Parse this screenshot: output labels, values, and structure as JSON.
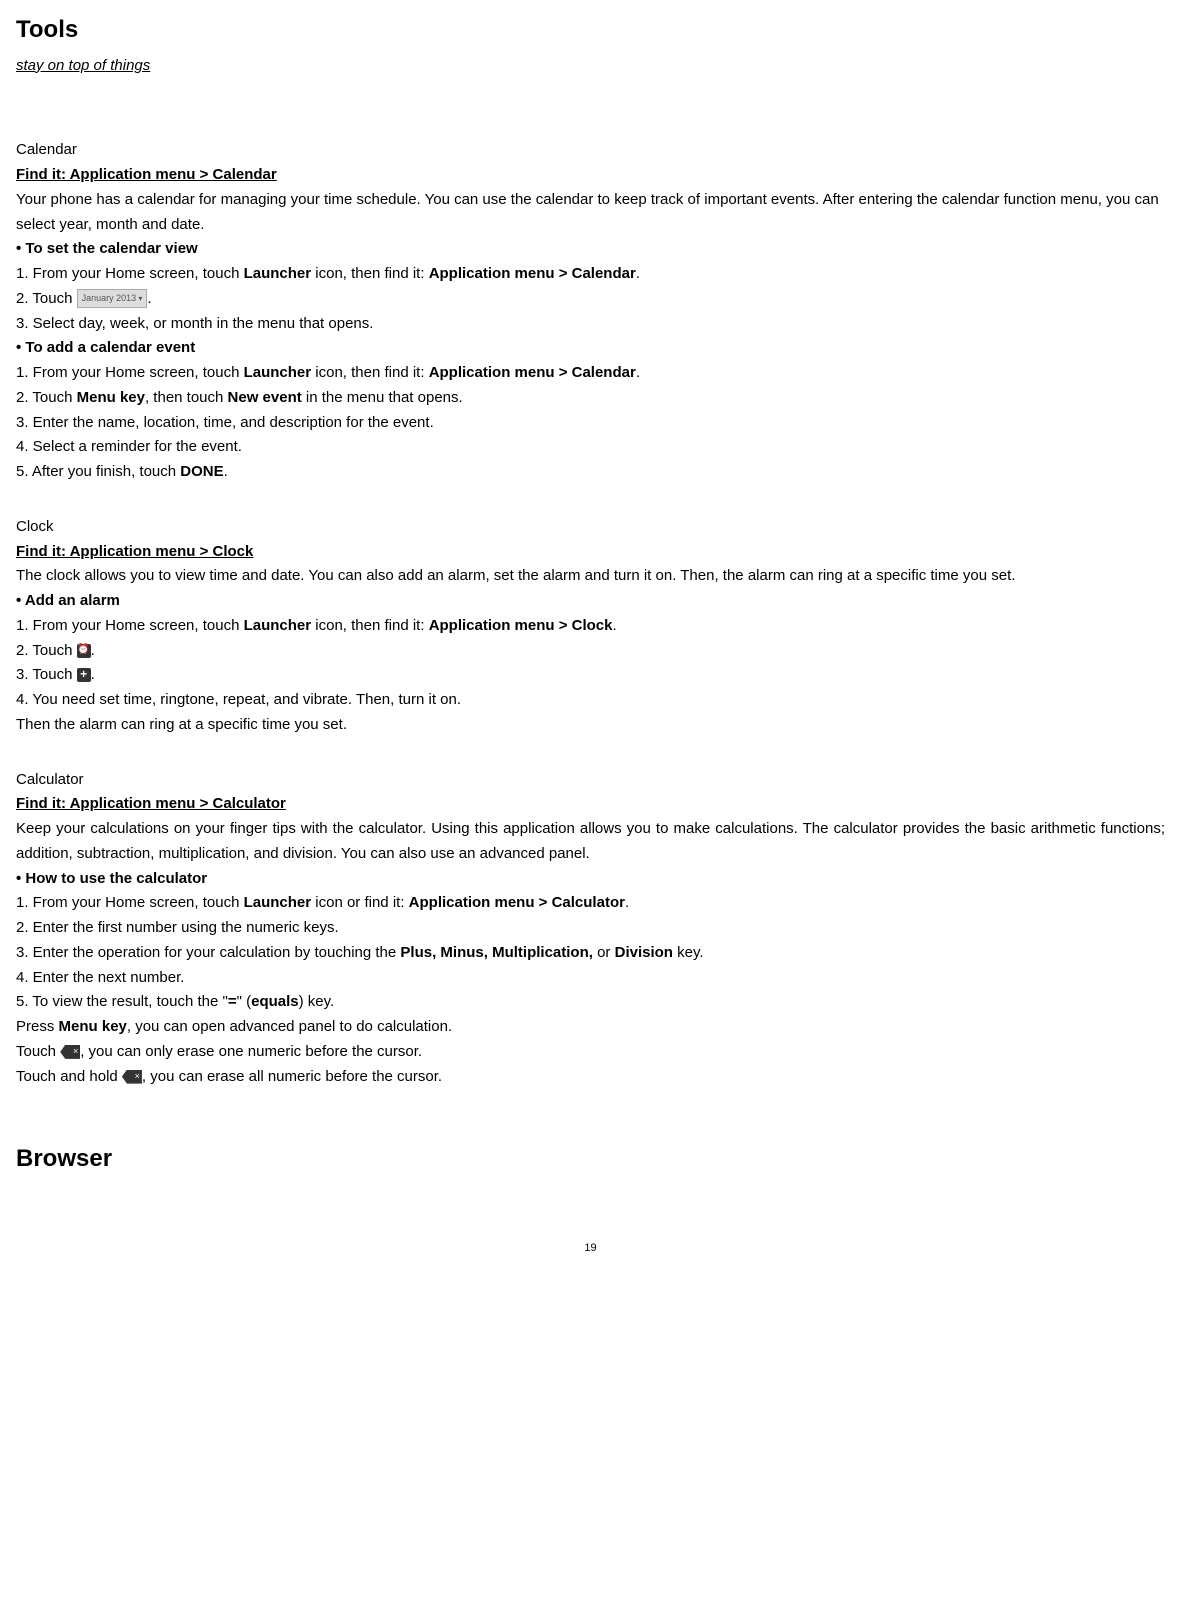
{
  "page_number": "19",
  "title": "Tools",
  "subtitle": "stay on top of things",
  "calendar": {
    "heading": "Calendar",
    "findit": "Find it: Application menu > Calendar",
    "intro": "Your phone has a calendar for managing your time schedule. You can use the calendar to keep track of important events. After entering the calendar function menu, you can select year, month and date.",
    "sub1_title": "• To set the calendar view",
    "s1_step1_a": "1. From your Home screen, touch ",
    "s1_step1_b": "Launcher",
    "s1_step1_c": " icon, then find it: ",
    "s1_step1_d": "Application menu > Calendar",
    "s1_step1_e": ".",
    "s1_step2_a": "2. Touch ",
    "s1_step2_b": ".",
    "s1_step3": "3. Select day, week, or month in the menu that opens.",
    "sub2_title": "• To add a calendar event",
    "s2_step1_a": "1. From your Home screen, touch ",
    "s2_step1_b": "Launcher",
    "s2_step1_c": " icon, then find it: ",
    "s2_step1_d": "Application menu > Calendar",
    "s2_step1_e": ".",
    "s2_step2_a": "2. Touch ",
    "s2_step2_b": "Menu key",
    "s2_step2_c": ", then touch ",
    "s2_step2_d": "New event",
    "s2_step2_e": " in the menu that opens.",
    "s2_step3": "3. Enter the name, location, time, and description for the event.",
    "s2_step4": "4. Select a reminder for the event.",
    "s2_step5_a": "5. After you finish, touch ",
    "s2_step5_b": "DONE",
    "s2_step5_c": "."
  },
  "clock": {
    "heading": "Clock",
    "findit": "Find it: Application menu > Clock",
    "intro": "The clock allows you to view time and date. You can also add an alarm, set the alarm and turn it on. Then, the alarm can ring at a specific time you set.",
    "sub1_title": "• Add an alarm",
    "s1_step1_a": "1. From your Home screen, touch ",
    "s1_step1_b": "Launcher",
    "s1_step1_c": " icon, then find it: ",
    "s1_step1_d": "Application menu > Clock",
    "s1_step1_e": ".",
    "s1_step2_a": "2. Touch ",
    "s1_step2_b": ".",
    "s1_step3_a": "3. Touch ",
    "s1_step3_b": ".",
    "s1_step4": "4. You need set time, ringtone, repeat, and vibrate. Then, turn it on.",
    "note": "Then the alarm can ring at a specific time you set."
  },
  "calculator": {
    "heading": "Calculator",
    "findit": "Find it: Application menu > Calculator",
    "intro": "Keep your calculations on your finger tips with the calculator. Using this application allows you to make calculations. The calculator provides the basic arithmetic functions; addition, subtraction, multiplication, and division. You can also use an advanced panel.",
    "sub1_title": "• How to use the calculator",
    "step1_a": "1. From your Home screen, touch ",
    "step1_b": "Launcher",
    "step1_c": " icon or find it: ",
    "step1_d": "Application menu > Calculator",
    "step1_e": ".",
    "step2": "2. Enter the first number using the numeric keys.",
    "step3_a": "3. Enter the operation for your calculation by touching the ",
    "step3_b": "Plus, Minus, Multiplication,",
    "step3_c": " or ",
    "step3_d": "Division",
    "step3_e": " key.",
    "step4": "4. Enter the next number.",
    "step5_a": "5. To view the result, touch the \"",
    "step5_b": "=",
    "step5_c": "\" (",
    "step5_d": "equals",
    "step5_e": ") key.",
    "press_a": "Press ",
    "press_b": "Menu key",
    "press_c": ", you can open advanced panel to do calculation.",
    "touch1_a": "Touch ",
    "touch1_b": ", you can only erase one numeric before the cursor.",
    "touch2_a": "Touch and hold ",
    "touch2_b": ", you can erase all numeric before the cursor."
  },
  "browser": {
    "heading": "Browser"
  },
  "icons": {
    "month_label": "January 2013",
    "alarm_glyph": "⏰",
    "plus_glyph": "+",
    "backspace_glyph": "×"
  }
}
